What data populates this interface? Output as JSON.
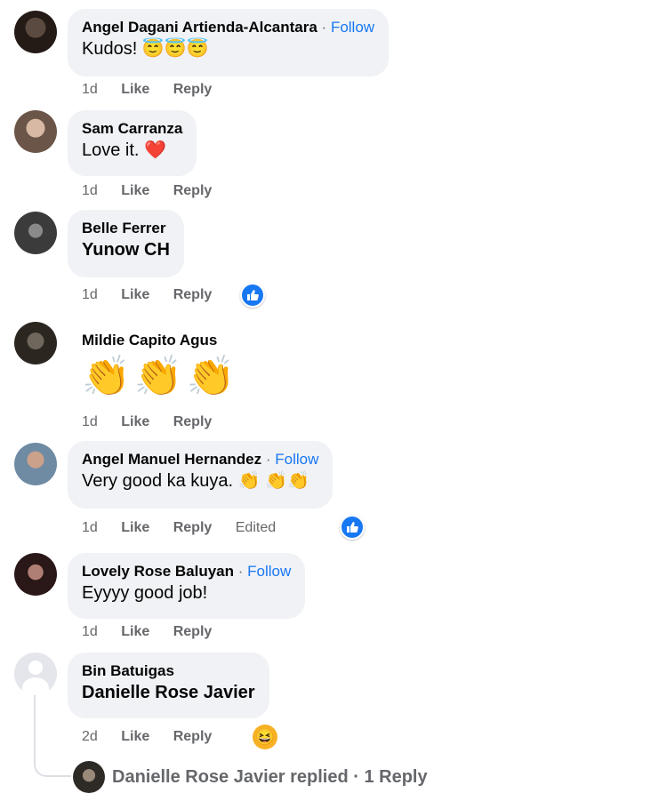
{
  "comments": [
    {
      "author": "Angel Dagani Artienda-Alcantara",
      "follow": "Follow",
      "text": "Kudos! 😇😇😇",
      "time": "1d",
      "like": "Like",
      "reply": "Reply"
    },
    {
      "author": "Sam Carranza",
      "text": "Love it. ❤️",
      "time": "1d",
      "like": "Like",
      "reply": "Reply"
    },
    {
      "author": "Belle Ferrer",
      "text": "Yunow CH",
      "time": "1d",
      "like": "Like",
      "reply": "Reply",
      "reaction": "like-icon"
    },
    {
      "author": "Mildie Capito Agus",
      "text": "👏👏👏",
      "time": "1d",
      "like": "Like",
      "reply": "Reply"
    },
    {
      "author": "Angel Manuel Hernandez",
      "follow": "Follow",
      "text": "Very good ka kuya. 👏 👏👏",
      "time": "1d",
      "like": "Like",
      "reply": "Reply",
      "edited": "Edited",
      "reaction": "like-icon"
    },
    {
      "author": "Lovely Rose Baluyan",
      "follow": "Follow",
      "text": "Eyyyy good job!",
      "time": "1d",
      "like": "Like",
      "reply": "Reply"
    },
    {
      "author": "Bin Batuigas",
      "text": "Danielle Rose Javier",
      "time": "2d",
      "like": "Like",
      "reply": "Reply",
      "reaction": "haha-icon"
    }
  ],
  "replies_summary": {
    "text": "Danielle Rose Javier replied · 1 Reply"
  },
  "colors": {
    "accent": "#1877f2",
    "bubble": "#f0f2f5",
    "muted": "#65676b"
  }
}
